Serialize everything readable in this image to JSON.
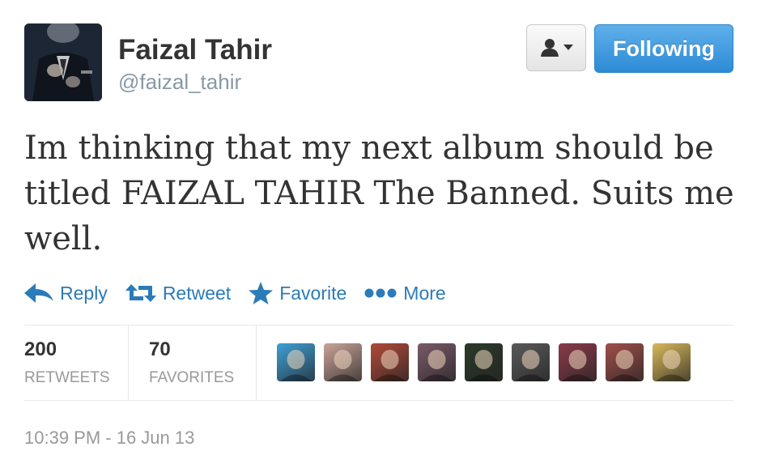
{
  "profile": {
    "name": "Faizal Tahir",
    "handle": "@faizal_tahir",
    "avatar_icon": "profile-photo"
  },
  "buttons": {
    "user_menu_icon": "person-icon",
    "follow_label": "Following"
  },
  "tweet": {
    "text": "Im thinking that my next album should be titled FAIZAL TAHIR The Banned. Suits me well."
  },
  "actions": [
    {
      "label": "Reply",
      "icon": "reply-icon"
    },
    {
      "label": "Retweet",
      "icon": "retweet-icon"
    },
    {
      "label": "Favorite",
      "icon": "star-icon"
    },
    {
      "label": "More",
      "icon": "more-dots-icon"
    }
  ],
  "stats": {
    "retweets_count": "200",
    "retweets_label": "RETWEETS",
    "favorites_count": "70",
    "favorites_label": "FAVORITES"
  },
  "favoriters": [
    {
      "name": "favoriter-avatar-1",
      "color": "#3fa0d6"
    },
    {
      "name": "favoriter-avatar-2",
      "color": "#c9a49a"
    },
    {
      "name": "favoriter-avatar-3",
      "color": "#b04a3a"
    },
    {
      "name": "favoriter-avatar-4",
      "color": "#7a5a6a"
    },
    {
      "name": "favoriter-avatar-5",
      "color": "#2a3a2a"
    },
    {
      "name": "favoriter-avatar-6",
      "color": "#5a5a5a"
    },
    {
      "name": "favoriter-avatar-7",
      "color": "#8a3a4a"
    },
    {
      "name": "favoriter-avatar-8",
      "color": "#a0504a"
    },
    {
      "name": "favoriter-avatar-9",
      "color": "#d8b85a"
    }
  ],
  "meta": {
    "timestamp": "10:39 PM - 16 Jun 13"
  },
  "colors": {
    "link": "#2b7bb9",
    "follow_button": "#2d8bd6",
    "muted": "#999999"
  }
}
